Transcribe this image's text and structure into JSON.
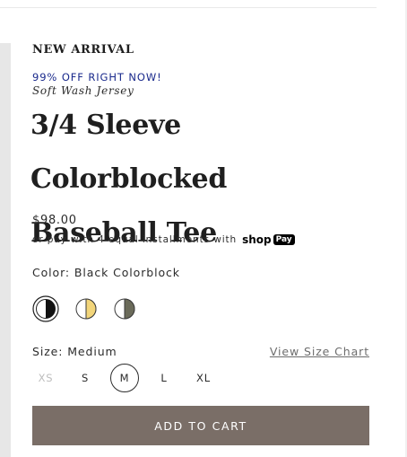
{
  "product": {
    "badge": "NEW ARRIVAL",
    "promo": "99% OFF RIGHT NOW!",
    "subtitle": "Soft Wash Jersey",
    "title_line1": "3/4 Sleeve Colorblocked",
    "title_line2": "Baseball Tee",
    "price": "$98.00",
    "installments_text": "or pay with 4 equal installments with",
    "shop_pay": {
      "word": "shop",
      "pay": "Pay"
    }
  },
  "color": {
    "label": "Color:",
    "selected_value": "Black Colorblock",
    "swatches": [
      {
        "name": "Black Colorblock",
        "left_color": "#ffffff",
        "right_color": "#111111",
        "selected": true
      },
      {
        "name": "Yellow Colorblock",
        "left_color": "#ffffff",
        "right_color": "#f2d57a",
        "selected": false
      },
      {
        "name": "Olive Colorblock",
        "left_color": "#ffffff",
        "right_color": "#6b6b5a",
        "selected": false
      }
    ]
  },
  "size": {
    "label": "Size:",
    "selected_value": "Medium",
    "chart_link": "View Size Chart",
    "options": [
      {
        "label": "XS",
        "available": false,
        "selected": false
      },
      {
        "label": "S",
        "available": true,
        "selected": false
      },
      {
        "label": "M",
        "available": true,
        "selected": true
      },
      {
        "label": "L",
        "available": true,
        "selected": false
      },
      {
        "label": "XL",
        "available": true,
        "selected": false
      }
    ]
  },
  "actions": {
    "add_to_cart": "ADD TO CART"
  },
  "colors": {
    "promo": "#1a2a8c",
    "button_bg": "#7a6e67",
    "button_text": "#ffffff"
  }
}
